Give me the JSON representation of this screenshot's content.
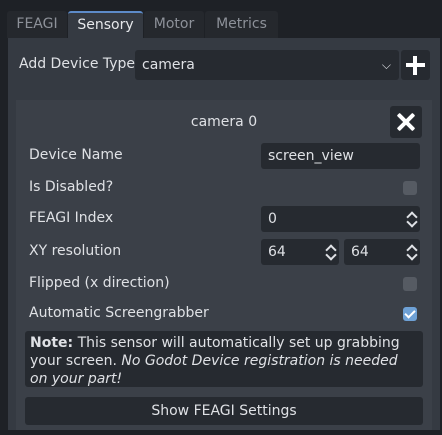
{
  "tabs": [
    {
      "label": "FEAGI",
      "active": false
    },
    {
      "label": "Sensory",
      "active": true
    },
    {
      "label": "Motor",
      "active": false
    },
    {
      "label": "Metrics",
      "active": false
    }
  ],
  "add_device": {
    "label": "Add Device Type",
    "selected": "camera",
    "add_icon": "plus-icon"
  },
  "device_card": {
    "title": "camera 0",
    "close_icon": "close-icon",
    "device_name": {
      "label": "Device Name",
      "value": "screen_view"
    },
    "is_disabled": {
      "label": "Is Disabled?",
      "checked": false
    },
    "feagi_index": {
      "label": "FEAGI Index",
      "value": "0"
    },
    "xy_resolution": {
      "label": "XY resolution",
      "x": "64",
      "y": "64"
    },
    "flipped": {
      "label": "Flipped (x direction)",
      "checked": false
    },
    "auto_screengrabber": {
      "label": "Automatic Screengrabber",
      "checked": true
    },
    "note": {
      "bold": "Note:",
      "text": " This sensor will automatically set up grabbing your screen. ",
      "italic": "No Godot Device registration is needed on your part!"
    },
    "settings_button": "Show FEAGI Settings"
  },
  "colors": {
    "background": "#1e2126",
    "panel": "#353a42",
    "card": "#3b4048",
    "field": "#262a30",
    "accent": "#6ea1d6"
  }
}
